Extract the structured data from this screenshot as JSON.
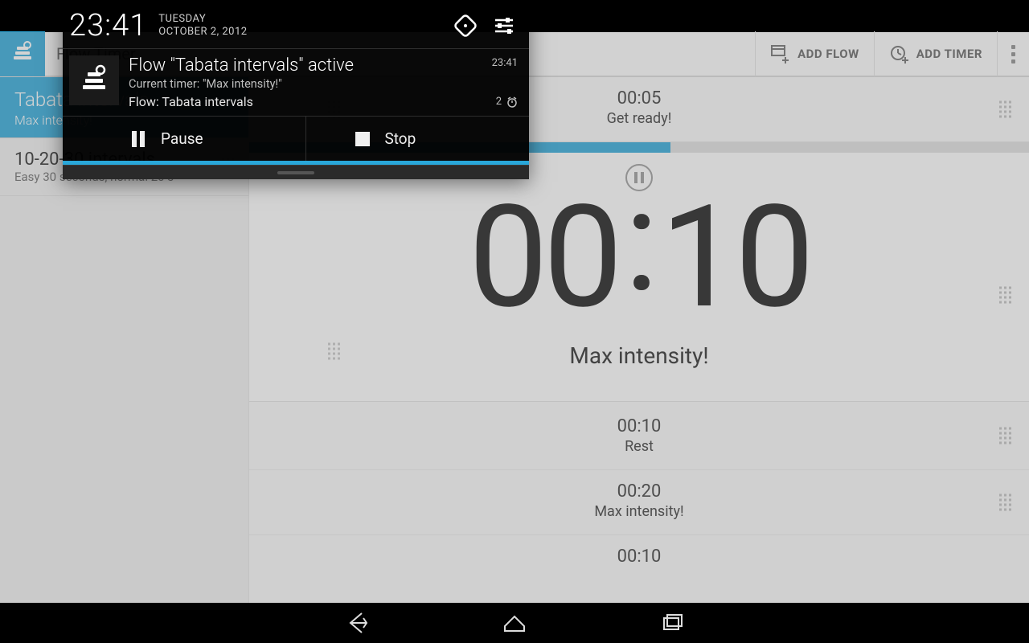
{
  "status": {
    "time": "23:41",
    "day": "TUESDAY",
    "date": "OCTOBER 2, 2012"
  },
  "actionbar": {
    "title": "Flow Timer",
    "add_flow": "ADD FLOW",
    "add_timer": "ADD TIMER"
  },
  "sidebar": {
    "active": {
      "title": "Tabata intervals",
      "subtitle": "Max intensity!"
    },
    "items": [
      {
        "title": "10-20-30 intervals",
        "subtitle": "Easy 30 seconds, normal 20 s"
      }
    ]
  },
  "timer": {
    "top": {
      "time": "00:05",
      "label": "Get ready!"
    },
    "current": {
      "time_mm": "00",
      "time_ss": "10",
      "label": "Max intensity!",
      "progress_pct": 54
    },
    "upcoming": [
      {
        "time": "00:10",
        "label": "Rest"
      },
      {
        "time": "00:20",
        "label": "Max intensity!"
      },
      {
        "time": "00:10",
        "label": ""
      }
    ]
  },
  "notification": {
    "title": "Flow \"Tabata intervals\" active",
    "sub": "Current timer: \"Max intensity!\"",
    "line": "Flow: Tabata intervals",
    "time": "23:41",
    "count": "2",
    "actions": {
      "pause": "Pause",
      "stop": "Stop"
    }
  }
}
